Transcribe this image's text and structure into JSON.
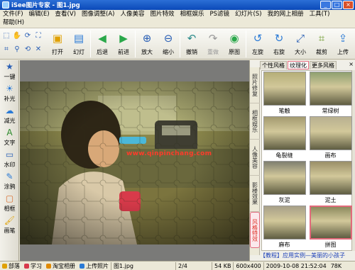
{
  "window": {
    "title": "iSee图片专家 - 图1.jpg",
    "controls": [
      "_",
      "□",
      "×"
    ]
  },
  "menu": {
    "row1": [
      "文件(F)",
      "编辑(E)",
      "查看(V)",
      "图像调整(A)",
      "人像美容",
      "图片特效",
      "相框娱乐",
      "PS滤镜",
      "幻灯片(S)",
      "我的网上相册",
      "工具(T)"
    ],
    "row2": [
      "帮助(H)"
    ]
  },
  "toolbar": {
    "buttons": [
      {
        "label": "打开",
        "icon": "folder-icon",
        "color": "#e0a000"
      },
      {
        "label": "幻灯",
        "icon": "slideshow-icon",
        "color": "#2a7ad6"
      },
      {
        "label": "后退",
        "icon": "back-arrow-icon",
        "color": "#2aa84a"
      },
      {
        "label": "前进",
        "icon": "forward-arrow-icon",
        "color": "#2aa84a"
      },
      {
        "label": "放大",
        "icon": "zoom-in-icon",
        "color": "#2a5fb5"
      },
      {
        "label": "缩小",
        "icon": "zoom-out-icon",
        "color": "#2a5fb5"
      },
      {
        "label": "撤销",
        "icon": "undo-icon",
        "color": "#2a8a8a"
      },
      {
        "label": "重做",
        "icon": "redo-icon",
        "color": "#9a9a9a",
        "disabled": true
      },
      {
        "label": "原图",
        "icon": "original-image-icon",
        "color": "#2aa84a"
      },
      {
        "label": "左旋",
        "icon": "rotate-left-icon",
        "color": "#2a7ad6"
      },
      {
        "label": "右旋",
        "icon": "rotate-right-icon",
        "color": "#2a7ad6"
      },
      {
        "label": "大小",
        "icon": "resize-icon",
        "color": "#2a5fb5"
      },
      {
        "label": "裁剪",
        "icon": "crop-icon",
        "color": "#6a9a2a"
      },
      {
        "label": "上传",
        "icon": "upload-icon",
        "color": "#2a7ad6"
      }
    ],
    "small_tools": [
      "select-icon",
      "hand-icon",
      "rotate-icon",
      "fullscreen-icon",
      "crop-tool-icon",
      "zoom-tool-icon",
      "refresh-icon",
      "close-icon"
    ]
  },
  "left_tools": [
    {
      "label": "一键",
      "icon": "one-click-icon"
    },
    {
      "label": "补光",
      "icon": "fill-light-icon"
    },
    {
      "label": "减光",
      "icon": "reduce-light-icon"
    },
    {
      "label": "文字",
      "icon": "text-icon"
    },
    {
      "label": "水印",
      "icon": "watermark-icon"
    },
    {
      "label": "涂鸦",
      "icon": "doodle-icon"
    },
    {
      "label": "相框",
      "icon": "frame-icon"
    },
    {
      "label": "画笔",
      "icon": "brush-icon"
    }
  ],
  "canvas": {
    "watermark": "www.qinpinchang.com"
  },
  "right_panel": {
    "vertical_tabs": [
      "照片修复",
      "相框娱乐",
      "人像美容",
      "影楼效果",
      "风格特效"
    ],
    "active_vertical": 4,
    "tabs": [
      "个性风格",
      "纹理化",
      "更多风格"
    ],
    "active_tab": 1,
    "thumbnails": [
      {
        "label": "笔触"
      },
      {
        "label": "常绿树"
      },
      {
        "label": "龟裂缝"
      },
      {
        "label": "画布"
      },
      {
        "label": "灰泥"
      },
      {
        "label": "泥土"
      },
      {
        "label": "麻布"
      },
      {
        "label": "拼图",
        "selected": true
      }
    ],
    "close": "×",
    "link": "【教程】应用实例—美丽的小孩子"
  },
  "statusbar": {
    "items": [
      "部落",
      "学习",
      "淘宝相册",
      "上传照片"
    ],
    "filename": "图1.jpg",
    "page": "2/4",
    "size": "54 KB",
    "dims": "600x400",
    "date": "2009-10-08 21:52:04",
    "extra": "78K"
  }
}
